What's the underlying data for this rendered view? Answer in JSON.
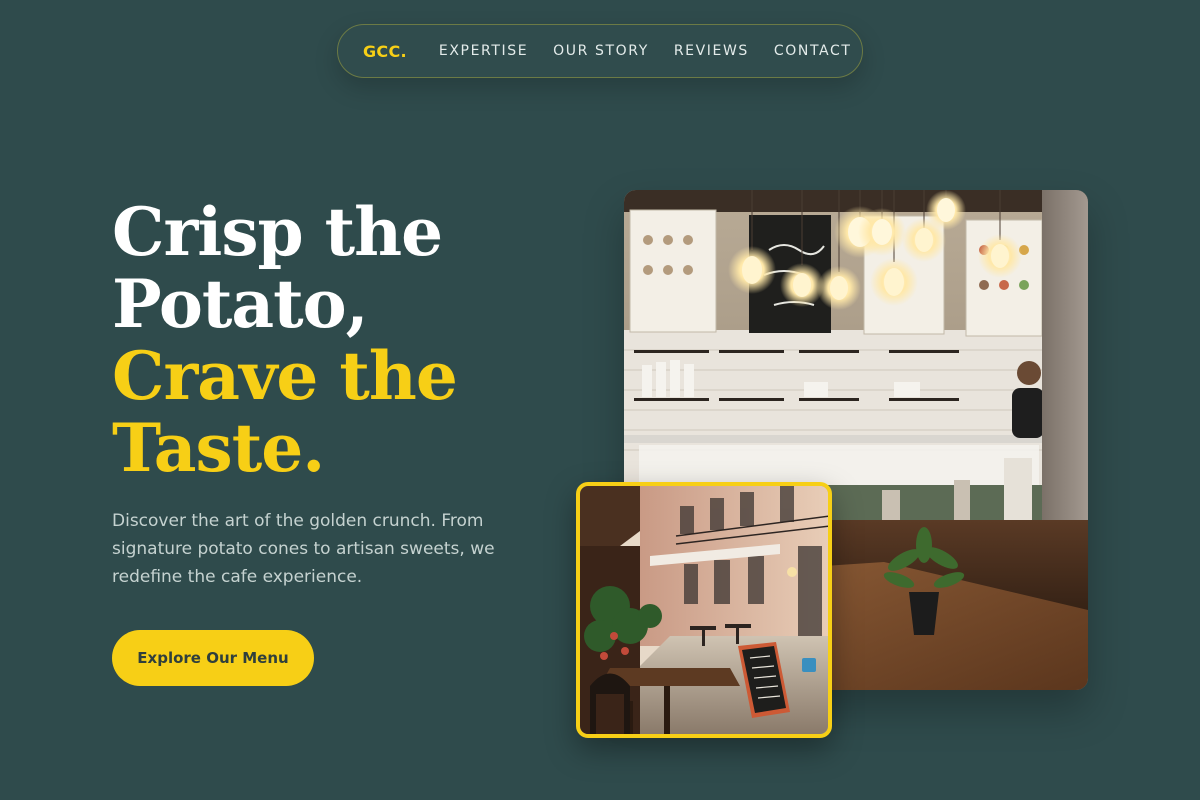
{
  "nav": {
    "logo": "GCC.",
    "links": [
      "EXPERTISE",
      "OUR STORY",
      "REVIEWS",
      "CONTACT"
    ]
  },
  "hero": {
    "line1": "Crisp the",
    "line2": "Potato,",
    "line3": "Crave the",
    "line4": "Taste.",
    "description": "Discover the art of the golden crunch. From signature potato cones to artisan sweets, we redefine the cafe experience.",
    "cta_label": "Explore Our Menu"
  },
  "images": {
    "main": "cafe-interior-photo",
    "secondary": "street-cafe-photo"
  },
  "colors": {
    "background": "#2f4b4c",
    "accent": "#f7cf16",
    "text": "#ffffff",
    "muted_text": "#c5d2d0"
  }
}
